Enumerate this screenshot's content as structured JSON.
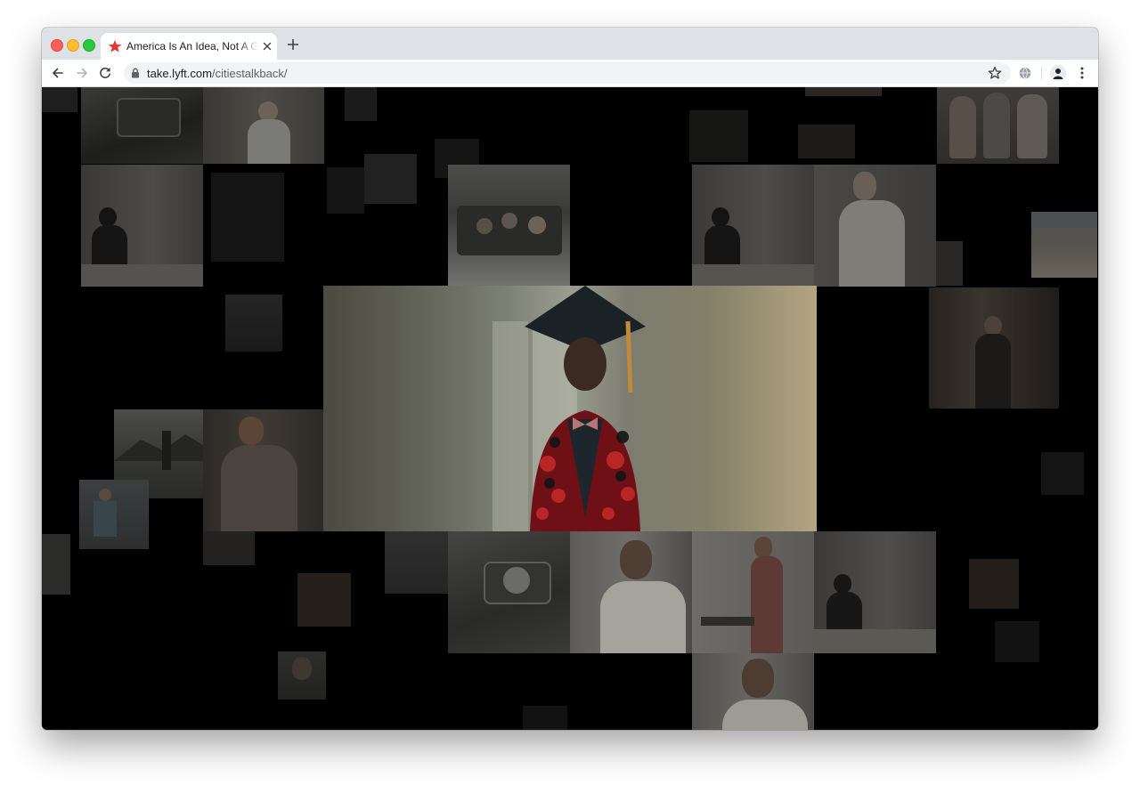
{
  "browser": {
    "tab": {
      "title": "America Is An Idea, Not A Geography",
      "favicon": "red-star-icon"
    },
    "toolbar": {
      "url_domain": "take.lyft.com",
      "url_path": "/citiestalkback/"
    }
  },
  "colors": {
    "favicon": "#e8342c",
    "page_background": "#000000",
    "chrome_tabstrip": "#dee1e6",
    "omnibox": "#f1f3f4"
  },
  "icons": {
    "back": "back-arrow-icon",
    "forward": "forward-arrow-icon",
    "reload": "reload-icon",
    "lock": "lock-icon",
    "bookmark": "star-icon",
    "extension": "globe-icon",
    "profile": "avatar-icon",
    "menu": "kebab-menu-icon",
    "new_tab": "plus-icon",
    "close_tab": "close-icon"
  }
}
